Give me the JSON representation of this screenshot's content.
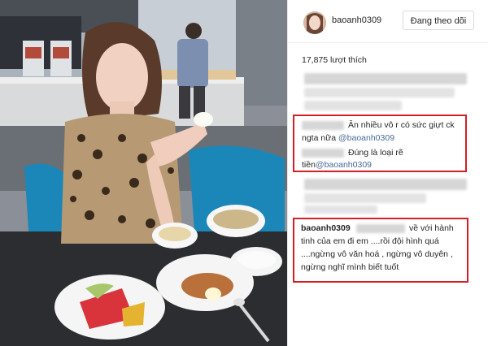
{
  "post": {
    "username": "baoanh0309",
    "follow_button": "Đang theo dõi",
    "likes": "17,875 lượt thích"
  },
  "comments": [
    {
      "line1_text": "Ăn nhiều vô r có sức giựt ck",
      "line2_prefix": "ngta nữa ",
      "line2_mention": "@baoanh0309"
    },
    {
      "line1_text": "Đúng là loại rẽ",
      "line2_prefix": "tiền",
      "line2_mention": "@baoanh0309"
    }
  ],
  "reply": {
    "author": "baoanh0309",
    "line1_text": "về với hành",
    "line2": "tinh của em đi em ....rồi đội hình quá",
    "line3": "....ngừng vô văn hoá , ngừng vô duyên ,",
    "line4": "ngừng nghĩ mình biết tuốt"
  },
  "colors": {
    "highlight_box": "#d31f26",
    "mention": "#4a6a96"
  }
}
